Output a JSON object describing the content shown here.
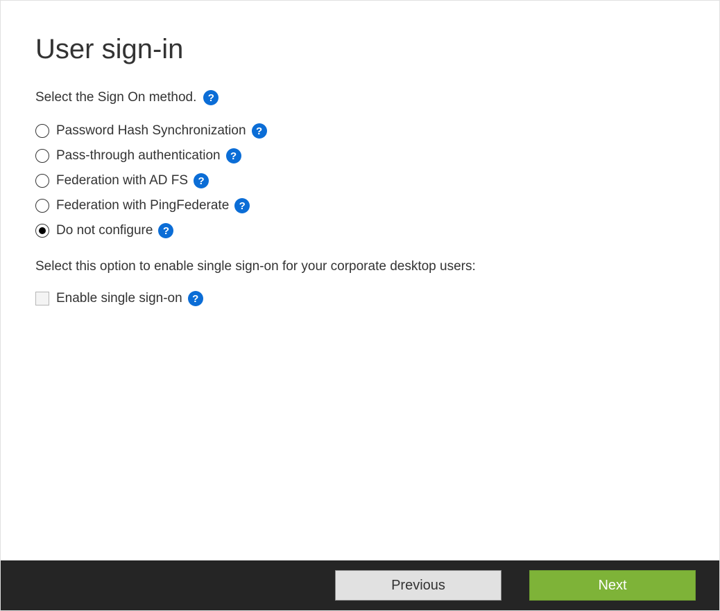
{
  "page": {
    "title": "User sign-in",
    "subtitle": "Select the Sign On method.",
    "sso_text": "Select this option to enable single sign-on for your corporate desktop users:"
  },
  "options": [
    {
      "label": "Password Hash Synchronization",
      "selected": false
    },
    {
      "label": "Pass-through authentication",
      "selected": false
    },
    {
      "label": "Federation with AD FS",
      "selected": false
    },
    {
      "label": "Federation with PingFederate",
      "selected": false
    },
    {
      "label": "Do not configure",
      "selected": true
    }
  ],
  "sso_checkbox": {
    "label": "Enable single sign-on",
    "checked": false
  },
  "footer": {
    "previous_label": "Previous",
    "next_label": "Next"
  },
  "help_glyph": "?"
}
